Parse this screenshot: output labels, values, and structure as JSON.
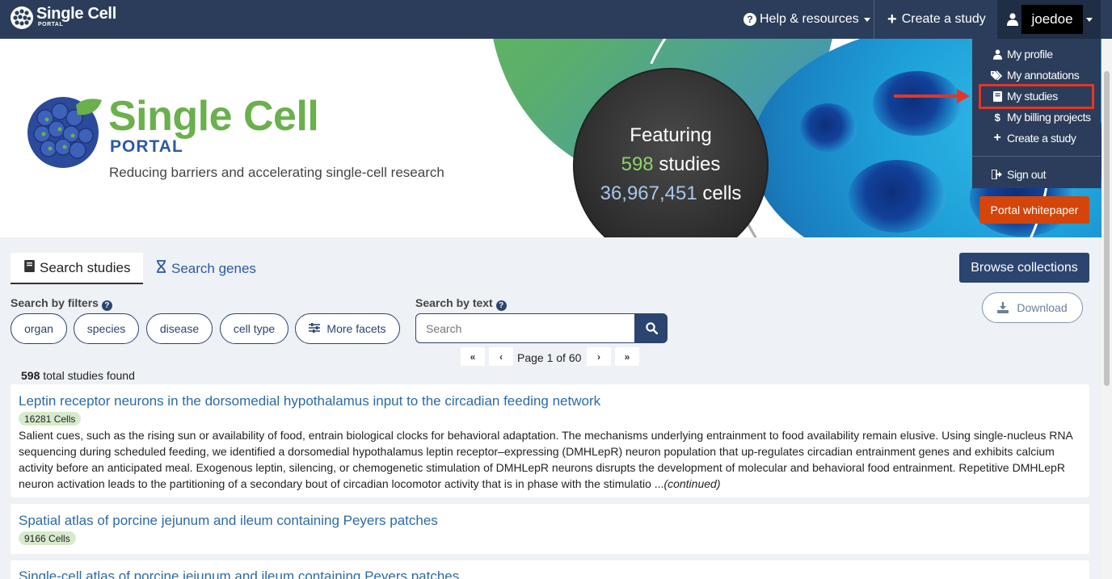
{
  "navbar": {
    "brand_title": "Single Cell",
    "brand_sub": "PORTAL",
    "help_label": "Help & resources",
    "create_label": "Create a study",
    "username": "joedoe"
  },
  "user_menu": {
    "items": [
      {
        "label": "My profile",
        "icon": "user-icon"
      },
      {
        "label": "My annotations",
        "icon": "tags-icon"
      },
      {
        "label": "My studies",
        "icon": "book-icon"
      },
      {
        "label": "My billing projects",
        "icon": "dollar-icon"
      },
      {
        "label": "Create a study",
        "icon": "plus-icon"
      }
    ],
    "signout_label": "Sign out",
    "highlighted_item": "My studies"
  },
  "hero": {
    "title": "Single Cell",
    "portal": "PORTAL",
    "tagline": "Reducing barriers and accelerating single-cell research",
    "featuring_label": "Featuring",
    "studies_count": "598",
    "studies_label": "studies",
    "cells_count": "36,967,451",
    "cells_label": "cells",
    "whitepaper_label": "Portal whitepaper"
  },
  "search": {
    "tab_studies": "Search studies",
    "tab_genes": "Search genes",
    "browse_label": "Browse collections",
    "filters_label": "Search by filters",
    "text_label": "Search by text",
    "facets": [
      "organ",
      "species",
      "disease",
      "cell type"
    ],
    "more_facets_label": "More facets",
    "placeholder": "Search",
    "download_label": "Download",
    "page_text": "Page 1 of 60",
    "total_count": "598",
    "total_label": "total studies found"
  },
  "results": [
    {
      "title": "Leptin receptor neurons in the dorsomedial hypothalamus input to the circadian feeding network",
      "cells": "16281 Cells",
      "description": "Salient cues, such as the rising sun or availability of food, entrain biological clocks for behavioral adaptation. The mechanisms underlying entrainment to food availability remain elusive. Using single-nucleus RNA sequencing during scheduled feeding, we identified a dorsomedial hypothalamus leptin receptor–expressing (DMHLepR) neuron population that up-regulates circadian entrainment genes and exhibits calcium activity before an anticipated meal. Exogenous leptin, silencing, or chemogenetic stimulation of DMHLepR neurons disrupts the development of molecular and behavioral food entrainment. Repetitive DMHLepR neuron activation leads to the partitioning of a secondary bout of circadian locomotor activity that is in phase with the stimulatio ...",
      "continued": "(continued)"
    },
    {
      "title": "Spatial atlas of porcine jejunum and ileum containing Peyers patches",
      "cells": "9166 Cells"
    },
    {
      "title": "Single-cell atlas of porcine jejunum and ileum containing Peyers patches"
    }
  ]
}
